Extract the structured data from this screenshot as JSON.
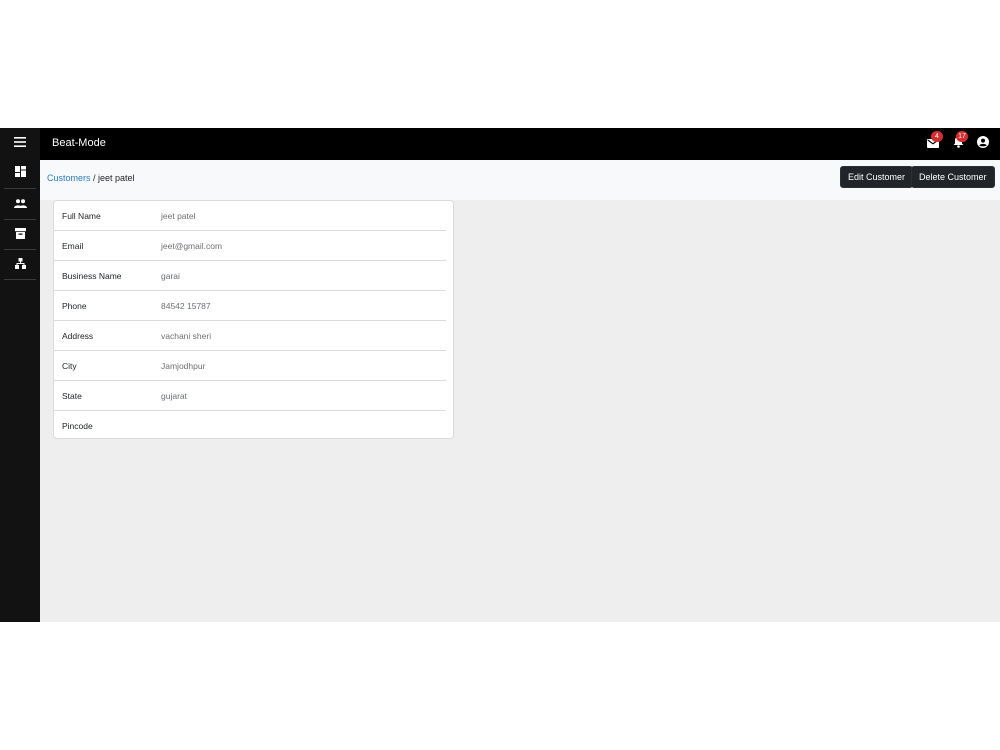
{
  "app": {
    "title": "Beat-Mode"
  },
  "sidebar": {
    "menu_icon": "menu-icon",
    "items": [
      {
        "icon": "dashboard-icon"
      },
      {
        "icon": "people-icon"
      },
      {
        "icon": "archive-icon"
      },
      {
        "icon": "sitemap-icon"
      }
    ]
  },
  "topbar": {
    "mail_count": "4",
    "notification_count": "17"
  },
  "breadcrumb": {
    "parent": "Customers",
    "separator": " / ",
    "current": "jeet patel"
  },
  "actions": {
    "edit_label": "Edit Customer",
    "delete_label": "Delete Customer"
  },
  "customer": {
    "fields": [
      {
        "label": "Full Name",
        "value": "jeet patel"
      },
      {
        "label": "Email",
        "value": "jeet@gmail.com"
      },
      {
        "label": "Business Name",
        "value": "garai"
      },
      {
        "label": "Phone",
        "value": "84542 15787"
      },
      {
        "label": "Address",
        "value": "vachani sheri"
      },
      {
        "label": "City",
        "value": "Jamjodhpur"
      },
      {
        "label": "State",
        "value": "gujarat"
      },
      {
        "label": "Pincode",
        "value": ""
      }
    ]
  },
  "colors": {
    "topbar": "#000000",
    "sidebar": "#121212",
    "badge": "#d32f2f",
    "link": "#2b7cc4",
    "button": "#212529"
  }
}
